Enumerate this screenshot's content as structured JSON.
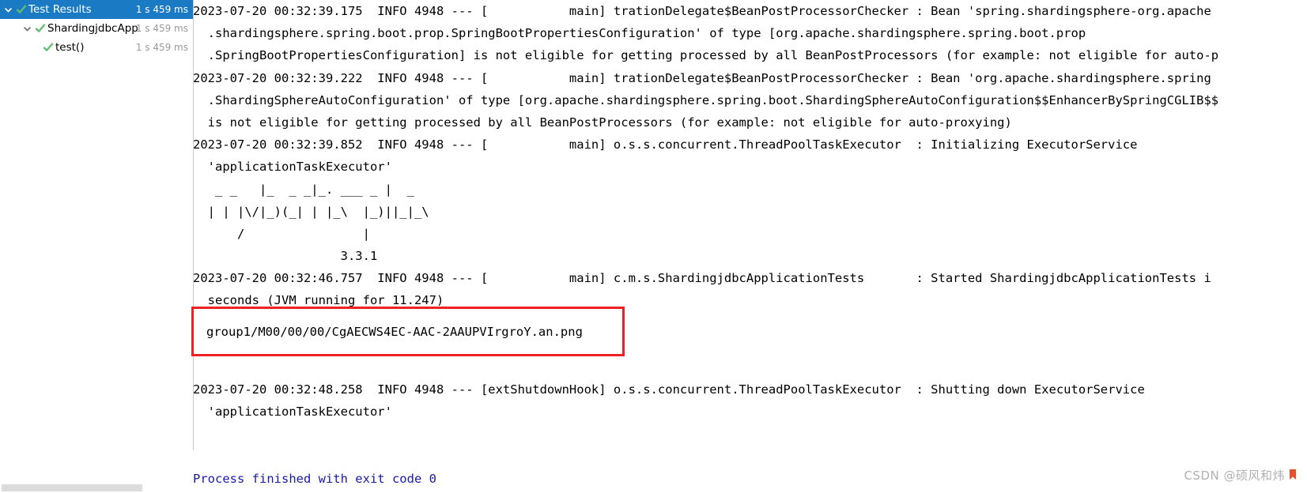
{
  "test_tree": {
    "rows": [
      {
        "label": "Test Results",
        "time": "1 s 459 ms",
        "indent": 0,
        "expanded": true,
        "selected": true,
        "status": "passed",
        "arrow": "chevron-down-icon",
        "name": "tree-row-test-results"
      },
      {
        "label": "ShardingjdbcApp",
        "time": "1 s 459 ms",
        "indent": 1,
        "expanded": true,
        "selected": false,
        "status": "passed",
        "arrow": "chevron-down-icon",
        "name": "tree-row-shardingjdbc-application-tests"
      },
      {
        "label": "test()",
        "time": "1 s 459 ms",
        "indent": 2,
        "expanded": false,
        "selected": false,
        "status": "passed",
        "arrow": "",
        "name": "tree-row-test-method"
      }
    ]
  },
  "console": {
    "lines": [
      "2023-07-20 00:32:39.175  INFO 4948 --- [           main] trationDelegate$BeanPostProcessorChecker : Bean 'spring.shardingsphere-org.apache",
      "  .shardingsphere.spring.boot.prop.SpringBootPropertiesConfiguration' of type [org.apache.shardingsphere.spring.boot.prop",
      "  .SpringBootPropertiesConfiguration] is not eligible for getting processed by all BeanPostProcessors (for example: not eligible for auto-p",
      "2023-07-20 00:32:39.222  INFO 4948 --- [           main] trationDelegate$BeanPostProcessorChecker : Bean 'org.apache.shardingsphere.spring",
      "  .ShardingSphereAutoConfiguration' of type [org.apache.shardingsphere.spring.boot.ShardingSphereAutoConfiguration$$EnhancerBySpringCGLIB$$",
      "  is not eligible for getting processed by all BeanPostProcessors (for example: not eligible for auto-proxying)",
      "2023-07-20 00:32:39.852  INFO 4948 --- [           main] o.s.s.concurrent.ThreadPoolTaskExecutor  : Initializing ExecutorService",
      "  'applicationTaskExecutor'",
      "   _ _   |_  _ _|_. ___ _ |  _",
      "  | | |\\/|_)(_| | |_\\  |_)||_|_\\",
      "      /                |",
      "                    3.3.1",
      "2023-07-20 00:32:46.757  INFO 4948 --- [           main] c.m.s.ShardingjdbcApplicationTests       : Started ShardingjdbcApplicationTests i",
      "  seconds (JVM running for 11.247)",
      "",
      "",
      "",
      "2023-07-20 00:32:48.258  INFO 4948 --- [extShutdownHook] o.s.s.concurrent.ThreadPoolTaskExecutor  : Shutting down ExecutorService",
      "  'applicationTaskExecutor'",
      "",
      ""
    ],
    "exit_line": "Process finished with exit code 0",
    "highlight": {
      "text": "group1/M00/00/00/CgAECWS4EC-AAC-2AAUPVIrgroY.an.png",
      "border_color": "#ee2222"
    }
  },
  "watermark": {
    "text": "CSDN @硕风和炜"
  },
  "colors": {
    "selection_blue": "#1a7bc4",
    "pass_green": "#59a869",
    "exit_blue": "#1a1aa8",
    "highlight_red": "#ee2222",
    "muted_gray": "#9a9a9a"
  }
}
